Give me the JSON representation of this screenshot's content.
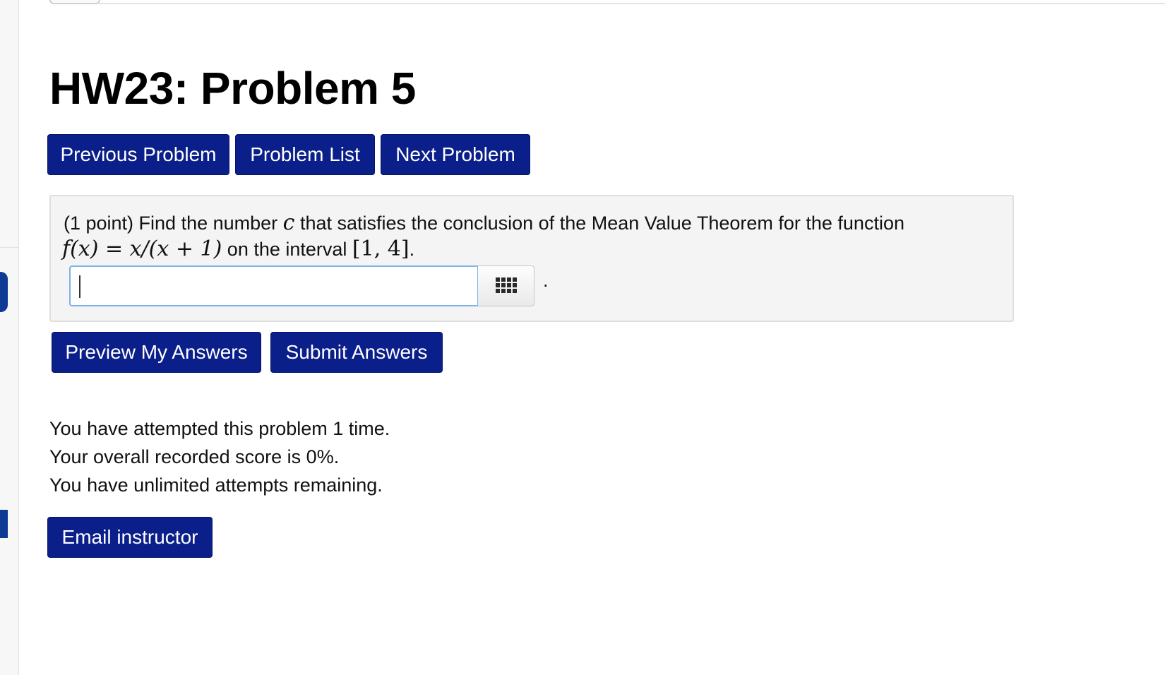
{
  "page": {
    "title": "HW23: Problem 5"
  },
  "nav": {
    "previous_label": "Previous Problem",
    "list_label": "Problem List",
    "next_label": "Next Problem"
  },
  "problem": {
    "intro": "(1 point) Find the number ",
    "variable": "c",
    "intro_rest": " that satisfies the conclusion of the Mean Value Theorem for the function",
    "function": "f(x) = x/(x + 1)",
    "interval_text": " on the interval ",
    "interval": "[1, 4]",
    "end_punct": ".",
    "answer_value": "",
    "trailing": "."
  },
  "actions": {
    "preview_label": "Preview My Answers",
    "submit_label": "Submit Answers"
  },
  "status": {
    "attempts": "You have attempted this problem 1 time.",
    "score": "Your overall recorded score is 0%.",
    "remaining": "You have unlimited attempts remaining."
  },
  "footer": {
    "email_label": "Email instructor"
  },
  "icons": {
    "palette": "grid-icon"
  },
  "colors": {
    "button_bg": "#0b1f8a",
    "rail_accent": "#0d3a94",
    "input_focus_border": "#7fb1ea",
    "problem_bg": "#f4f4f4"
  }
}
